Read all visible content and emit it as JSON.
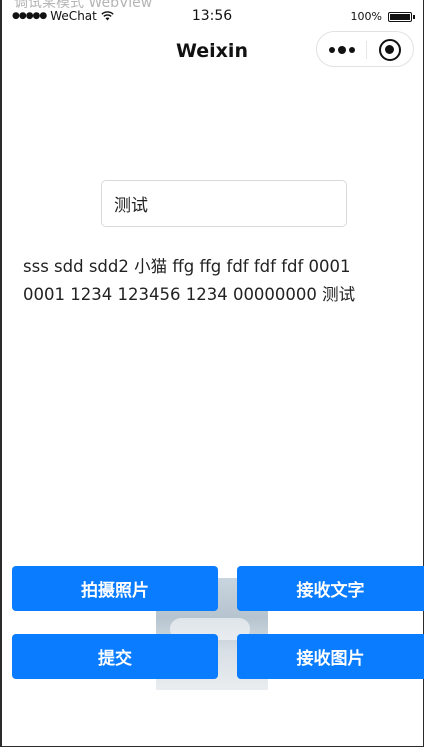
{
  "window_caption": "调试某模式 WebView",
  "status_bar": {
    "signal": "●●●●●",
    "carrier": "WeChat",
    "time": "13:56",
    "battery_percent": "100%"
  },
  "nav": {
    "title": "Weixin",
    "capsule_icons": [
      "more-icon",
      "close-icon"
    ]
  },
  "input": {
    "value": "测试"
  },
  "output_text": "sss sdd sdd2 小猫 ffg ffg fdf fdf fdf 0001 0001 1234 123456 1234 00000000 测试",
  "buttons": {
    "take_photo": "拍摄照片",
    "receive_text": "接收文字",
    "submit": "提交",
    "receive_image": "接收图片"
  },
  "colors": {
    "primary_button": "#0a7cff",
    "button_text": "#ffffff",
    "text": "#222222"
  }
}
